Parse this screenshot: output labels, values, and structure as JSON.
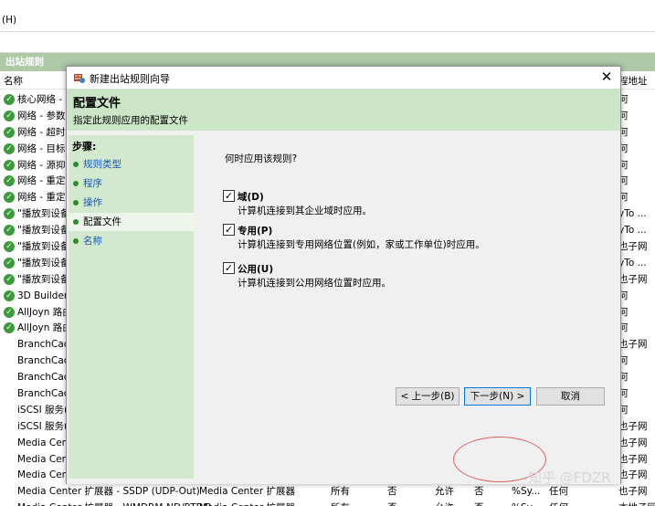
{
  "console": {
    "menu_fragment": "(H)",
    "pane_title": "出站规则",
    "col_name": "名称",
    "col_right": "程地址",
    "rows": [
      {
        "icon": true,
        "name": "核心网络 - ",
        "tail": "何"
      },
      {
        "icon": true,
        "name": "网络 - 参数",
        "tail": "何"
      },
      {
        "icon": true,
        "name": "网络 - 超时",
        "tail": "何"
      },
      {
        "icon": true,
        "name": "网络 - 目标",
        "tail": "何"
      },
      {
        "icon": true,
        "name": "网络 - 源抑",
        "tail": "何"
      },
      {
        "icon": true,
        "name": "网络 - 重定",
        "tail": "何"
      },
      {
        "icon": true,
        "name": "网络 - 重定",
        "tail": "何"
      },
      {
        "icon": true,
        "name": "\"播放到设备",
        "tail": "yTo ..."
      },
      {
        "icon": true,
        "name": "\"播放到设备",
        "tail": "yTo ..."
      },
      {
        "icon": true,
        "name": "\"播放到设备",
        "tail": "也子网"
      },
      {
        "icon": true,
        "name": "\"播放到设备",
        "tail": "yTo ..."
      },
      {
        "icon": true,
        "name": "\"播放到设备",
        "tail": "也子网"
      },
      {
        "icon": true,
        "name": "3D Builder",
        "tail": "何"
      },
      {
        "icon": true,
        "name": "AllJoyn 路由",
        "tail": "何"
      },
      {
        "icon": true,
        "name": "AllJoyn 路由",
        "tail": "何"
      },
      {
        "icon": false,
        "name": "BranchCach",
        "tail": "也子网"
      },
      {
        "icon": false,
        "name": "BranchCach",
        "tail": "何"
      },
      {
        "icon": false,
        "name": "BranchCach",
        "tail": "何"
      },
      {
        "icon": false,
        "name": "BranchCach",
        "tail": "何"
      },
      {
        "icon": false,
        "name": "iSCSI 服务(",
        "tail": "何"
      },
      {
        "icon": false,
        "name": "iSCSI 服务(",
        "tail": "也子网"
      },
      {
        "icon": false,
        "name": "Media Cen",
        "tail": "也子网"
      },
      {
        "icon": false,
        "name": "Media Cen",
        "tail": "也子网"
      },
      {
        "icon": false,
        "name": "Media Cen",
        "tail": "也子网"
      },
      {
        "icon": false,
        "name": "Media Center 扩展器 - SSDP (UDP-Out)",
        "c2": "Media Center 扩展器",
        "c3": "所有",
        "c4": "否",
        "c5": "允许",
        "c6": "否",
        "c7": "%Sy...",
        "c8": "任何",
        "tail": "也子网"
      },
      {
        "icon": false,
        "name": "Media Center 扩展器 - WMDRM-ND/RTP/R...",
        "c2": "Media Center 扩展器",
        "c3": "所有",
        "c4": "否",
        "c5": "允许",
        "c6": "否",
        "c7": "%Sy...",
        "c8": "任何",
        "tail": "本地子网"
      }
    ]
  },
  "dialog": {
    "title": "新建出站规则向导",
    "close_glyph": "✕",
    "header_title": "配置文件",
    "header_sub": "指定此规则应用的配置文件",
    "steps_head": "步骤:",
    "steps": [
      {
        "label": "规则类型",
        "active": false
      },
      {
        "label": "程序",
        "active": false
      },
      {
        "label": "操作",
        "active": false
      },
      {
        "label": "配置文件",
        "active": true
      },
      {
        "label": "名称",
        "active": false
      }
    ],
    "question": "何时应用该规则?",
    "options": [
      {
        "label": "域(D)",
        "desc": "计算机连接到其企业域时应用。",
        "checked": true
      },
      {
        "label": "专用(P)",
        "desc": "计算机连接到专用网络位置(例如，家或工作单位)时应用。",
        "checked": true
      },
      {
        "label": "公用(U)",
        "desc": "计算机连接到公用网络位置时应用。",
        "checked": true
      }
    ],
    "buttons": {
      "back": "< 上一步(B)",
      "next": "下一步(N) >",
      "cancel": "取消"
    }
  },
  "watermark": "知乎 @FDZR",
  "colors": {
    "accent_green": "#cde5c7",
    "pane_green": "#adc9a8",
    "link_blue": "#1a59b8",
    "highlight_red": "#e06060"
  }
}
